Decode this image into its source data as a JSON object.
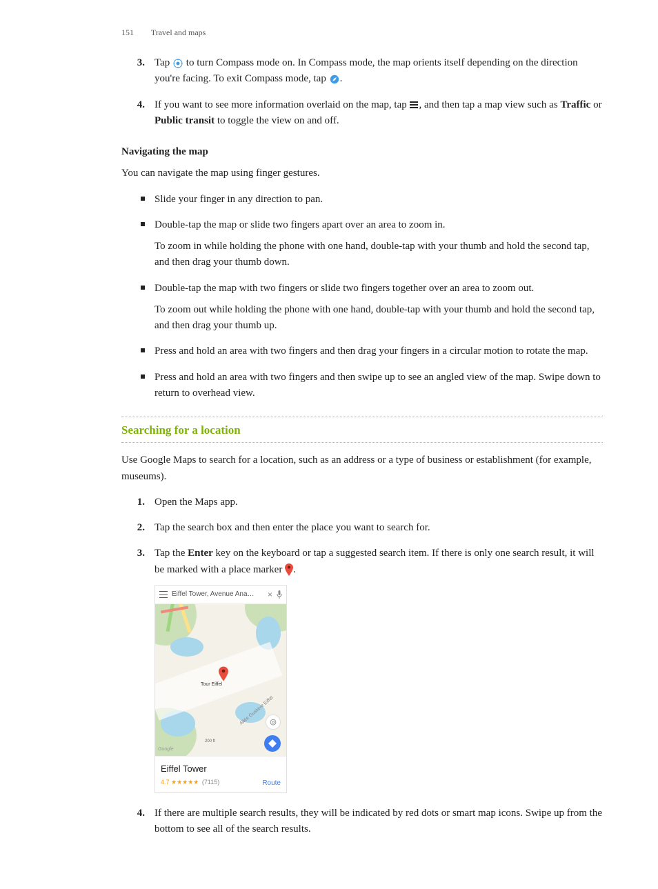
{
  "header": {
    "page_number": "151",
    "section": "Travel and maps"
  },
  "upper_list": {
    "item3": {
      "num": "3.",
      "t1": "Tap ",
      "t2": " to turn Compass mode on. In Compass mode, the map orients itself depending on the direction you're facing. To exit Compass mode, tap ",
      "t3": "."
    },
    "item4": {
      "num": "4.",
      "t1": "If you want to see more information overlaid on the map, tap ",
      "t2": ", and then tap a map view such as ",
      "bold1": "Traffic",
      "t3": " or ",
      "bold2": "Public transit",
      "t4": " to toggle the view on and off."
    }
  },
  "nav_heading": "Navigating the map",
  "nav_intro": "You can navigate the map using finger gestures.",
  "nav_bullets": {
    "b1": "Slide your finger in any direction to pan.",
    "b2": "Double-tap the map or slide two fingers apart over an area to zoom in.",
    "b2sub": "To zoom in while holding the phone with one hand, double-tap with your thumb and hold the second tap, and then drag your thumb down.",
    "b3": "Double-tap the map with two fingers or slide two fingers together over an area to zoom out.",
    "b3sub": "To zoom out while holding the phone with one hand, double-tap with your thumb and hold the second tap, and then drag your thumb up.",
    "b4": "Press and hold an area with two fingers and then drag your fingers in a circular motion to rotate the map.",
    "b5": "Press and hold an area with two fingers and then swipe up to see an angled view of the map. Swipe down to return to overhead view."
  },
  "search_heading": "Searching for a location",
  "search_intro": "Use Google Maps to search for a location, such as an address or a type of business or establishment (for example, museums).",
  "search_list": {
    "s1": {
      "num": "1.",
      "text": "Open the Maps app."
    },
    "s2": {
      "num": "2.",
      "text": "Tap the search box and then enter the place you want to search for."
    },
    "s3": {
      "num": "3.",
      "t1": "Tap the ",
      "bold": "Enter",
      "t2": " key on the keyboard or tap a suggested search item. If there is only one search result, it will be marked with a place marker ",
      "t3": "."
    },
    "s4": {
      "num": "4.",
      "text": "If there are multiple search results, they will be indicated by red dots or smart map icons. Swipe up from the bottom to see all of the search results."
    }
  },
  "screenshot": {
    "search_text": "Eiffel Tower, Avenue Ana…",
    "pin_label": "Tour Eiffel",
    "road_label": "Allée Gustave Eiffel",
    "scale_label": "200 ft",
    "google_label": "Google",
    "place_title": "Eiffel Tower",
    "rating_value": "4.7",
    "stars": "★★★★★",
    "rating_count": "(7115)",
    "route_label": "Route"
  }
}
